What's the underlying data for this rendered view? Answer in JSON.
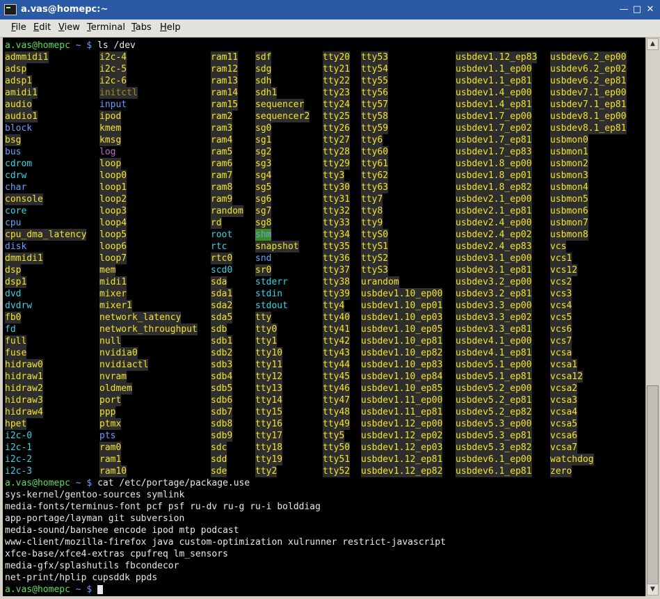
{
  "window": {
    "title": "a.vas@homepc:~",
    "minimize_glyph": "—",
    "maximize_glyph": "□",
    "close_glyph": "✕",
    "icons": [
      "terminal-app-icon",
      "minimize-icon",
      "maximize-icon",
      "close-icon"
    ]
  },
  "menu": [
    {
      "mn": "F",
      "rest": "ile"
    },
    {
      "mn": "E",
      "rest": "dit"
    },
    {
      "mn": "V",
      "rest": "iew"
    },
    {
      "mn": "T",
      "rest": "erminal"
    },
    {
      "mn": "T",
      "rest": "abs"
    },
    {
      "mn": "H",
      "rest": "elp"
    }
  ],
  "prompt": {
    "user": "a.vas@homepc",
    "dir": "~",
    "symbol": "$"
  },
  "commands": {
    "ls": "ls /dev",
    "cat": "cat /etc/portage/package.use"
  },
  "ls_columns": [
    [
      "admmidi1",
      "adsp",
      "adsp1",
      "amidi1",
      "audio",
      "audio1",
      "block",
      "bsg",
      "bus",
      "cdrom",
      "cdrw",
      "char",
      "console",
      "core",
      "cpu",
      "cpu_dma_latency",
      "disk",
      "dmmidi1",
      "dsp",
      "dsp1",
      "dvd",
      "dvdrw",
      "fb0",
      "fd",
      "full",
      "fuse",
      "hidraw0",
      "hidraw1",
      "hidraw2",
      "hidraw3",
      "hidraw4",
      "hpet",
      "i2c-0",
      "i2c-1",
      "i2c-2",
      "i2c-3"
    ],
    [
      "i2c-4",
      "i2c-5",
      "i2c-6",
      "initctl",
      "input",
      "ipod",
      "kmem",
      "kmsg",
      "log",
      "loop",
      "loop0",
      "loop1",
      "loop2",
      "loop3",
      "loop4",
      "loop5",
      "loop6",
      "loop7",
      "mem",
      "midi1",
      "mixer",
      "mixer1",
      "network_latency",
      "network_throughput",
      "null",
      "nvidia0",
      "nvidiactl",
      "nvram",
      "oldmem",
      "port",
      "ppp",
      "ptmx",
      "pts",
      "ram0",
      "ram1",
      "ram10"
    ],
    [
      "ram11",
      "ram12",
      "ram13",
      "ram14",
      "ram15",
      "ram2",
      "ram3",
      "ram4",
      "ram5",
      "ram6",
      "ram7",
      "ram8",
      "ram9",
      "random",
      "rd",
      "root",
      "rtc",
      "rtc0",
      "scd0",
      "sda",
      "sda1",
      "sda2",
      "sda5",
      "sdb",
      "sdb1",
      "sdb2",
      "sdb3",
      "sdb4",
      "sdb5",
      "sdb6",
      "sdb7",
      "sdb8",
      "sdb9",
      "sdc",
      "sdd",
      "sde"
    ],
    [
      "sdf",
      "sdg",
      "sdh",
      "sdh1",
      "sequencer",
      "sequencer2",
      "sg0",
      "sg1",
      "sg2",
      "sg3",
      "sg4",
      "sg5",
      "sg6",
      "sg7",
      "sg8",
      "shm",
      "snapshot",
      "snd",
      "sr0",
      "stderr",
      "stdin",
      "stdout",
      "tty",
      "tty0",
      "tty1",
      "tty10",
      "tty11",
      "tty12",
      "tty13",
      "tty14",
      "tty15",
      "tty16",
      "tty17",
      "tty18",
      "tty19",
      "tty2"
    ],
    [
      "tty20",
      "tty21",
      "tty22",
      "tty23",
      "tty24",
      "tty25",
      "tty26",
      "tty27",
      "tty28",
      "tty29",
      "tty3",
      "tty30",
      "tty31",
      "tty32",
      "tty33",
      "tty34",
      "tty35",
      "tty36",
      "tty37",
      "tty38",
      "tty39",
      "tty4",
      "tty40",
      "tty41",
      "tty42",
      "tty43",
      "tty44",
      "tty45",
      "tty46",
      "tty47",
      "tty48",
      "tty49",
      "tty5",
      "tty50",
      "tty51",
      "tty52"
    ],
    [
      "tty53",
      "tty54",
      "tty55",
      "tty56",
      "tty57",
      "tty58",
      "tty59",
      "tty6",
      "tty60",
      "tty61",
      "tty62",
      "tty63",
      "tty7",
      "tty8",
      "tty9",
      "ttyS0",
      "ttyS1",
      "ttyS2",
      "ttyS3",
      "urandom",
      "usbdev1.10_ep00",
      "usbdev1.10_ep01",
      "usbdev1.10_ep03",
      "usbdev1.10_ep05",
      "usbdev1.10_ep81",
      "usbdev1.10_ep82",
      "usbdev1.10_ep83",
      "usbdev1.10_ep84",
      "usbdev1.10_ep85",
      "usbdev1.11_ep00",
      "usbdev1.11_ep81",
      "usbdev1.12_ep00",
      "usbdev1.12_ep02",
      "usbdev1.12_ep03",
      "usbdev1.12_ep81",
      "usbdev1.12_ep82"
    ],
    [
      "usbdev1.12_ep83",
      "usbdev1.1_ep00",
      "usbdev1.1_ep81",
      "usbdev1.4_ep00",
      "usbdev1.4_ep81",
      "usbdev1.7_ep00",
      "usbdev1.7_ep02",
      "usbdev1.7_ep81",
      "usbdev1.7_ep83",
      "usbdev1.8_ep00",
      "usbdev1.8_ep01",
      "usbdev1.8_ep82",
      "usbdev2.1_ep00",
      "usbdev2.1_ep81",
      "usbdev2.4_ep00",
      "usbdev2.4_ep02",
      "usbdev2.4_ep83",
      "usbdev3.1_ep00",
      "usbdev3.1_ep81",
      "usbdev3.2_ep00",
      "usbdev3.2_ep81",
      "usbdev3.3_ep00",
      "usbdev3.3_ep02",
      "usbdev3.3_ep81",
      "usbdev4.1_ep00",
      "usbdev4.1_ep81",
      "usbdev5.1_ep00",
      "usbdev5.1_ep81",
      "usbdev5.2_ep00",
      "usbdev5.2_ep81",
      "usbdev5.2_ep82",
      "usbdev5.3_ep00",
      "usbdev5.3_ep81",
      "usbdev5.3_ep82",
      "usbdev6.1_ep00",
      "usbdev6.1_ep81"
    ],
    [
      "usbdev6.2_ep00",
      "usbdev6.2_ep02",
      "usbdev6.2_ep81",
      "usbdev7.1_ep00",
      "usbdev7.1_ep81",
      "usbdev8.1_ep00",
      "usbdev8.1_ep81",
      "usbmon0",
      "usbmon1",
      "usbmon2",
      "usbmon3",
      "usbmon4",
      "usbmon5",
      "usbmon6",
      "usbmon7",
      "usbmon8",
      "vcs",
      "vcs1",
      "vcs12",
      "vcs2",
      "vcs3",
      "vcs4",
      "vcs5",
      "vcs6",
      "vcs7",
      "vcsa",
      "vcsa1",
      "vcsa12",
      "vcsa2",
      "vcsa3",
      "vcsa4",
      "vcsa5",
      "vcsa6",
      "vcsa7",
      "watchdog",
      "zero"
    ]
  ],
  "ls_styles": {
    "dir": [
      "block",
      "bus",
      "char",
      "disk",
      "cpu",
      "input",
      "pts",
      "shm",
      "snd",
      "dri"
    ],
    "cyan": [
      "cdrom",
      "cdrw",
      "core",
      "dvd",
      "dvdrw",
      "fd",
      "rtc",
      "scd0",
      "stderr",
      "stdin",
      "stdout",
      "root"
    ],
    "green_dark": [],
    "pipe": [
      "initctl"
    ],
    "socket": [
      "log"
    ],
    "shm": [
      "shm"
    ]
  },
  "package_use": [
    "sys-kernel/gentoo-sources symlink",
    "media-fonts/terminus-font pcf psf ru-dv ru-g ru-i bolddiag",
    "app-portage/layman git subversion",
    "media-sound/banshee encode ipod mtp podcast",
    "www-client/mozilla-firefox java custom-optimization xulrunner restrict-javascript",
    "xfce-base/xfce4-extras cpufreq lm_sensors",
    "media-gfx/splashutils fbcondecor",
    "net-print/hplip cupsddk ppds"
  ],
  "colors": {
    "titlebar": "#2a5aa5",
    "terminal_bg": "#000000",
    "device_fg": "#f2e42a",
    "device_bg": "#2e2e2e",
    "dir_fg": "#6aa0ff",
    "link_fg": "#3ad2e6",
    "prompt_user": "#5ce05c"
  }
}
